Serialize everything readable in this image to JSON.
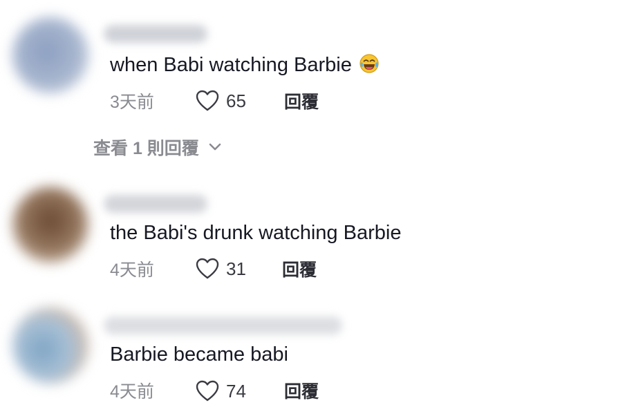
{
  "comments": [
    {
      "text": "when Babi watching Barbie",
      "emoji": "face-with-tears-of-joy",
      "time": "3天前",
      "likes": "65",
      "reply_label": "回覆"
    },
    {
      "text": "the Babi's drunk watching Barbie",
      "time": "4天前",
      "likes": "31",
      "reply_label": "回覆"
    },
    {
      "text": "Barbie became babi",
      "time": "4天前",
      "likes": "74",
      "reply_label": "回覆"
    }
  ],
  "view_replies": {
    "label": "查看 1 則回覆",
    "icon": "chevron-down-icon"
  },
  "colors": {
    "text_primary": "#161823",
    "text_secondary": "#8a8b91",
    "reply": "#2d2e35"
  }
}
